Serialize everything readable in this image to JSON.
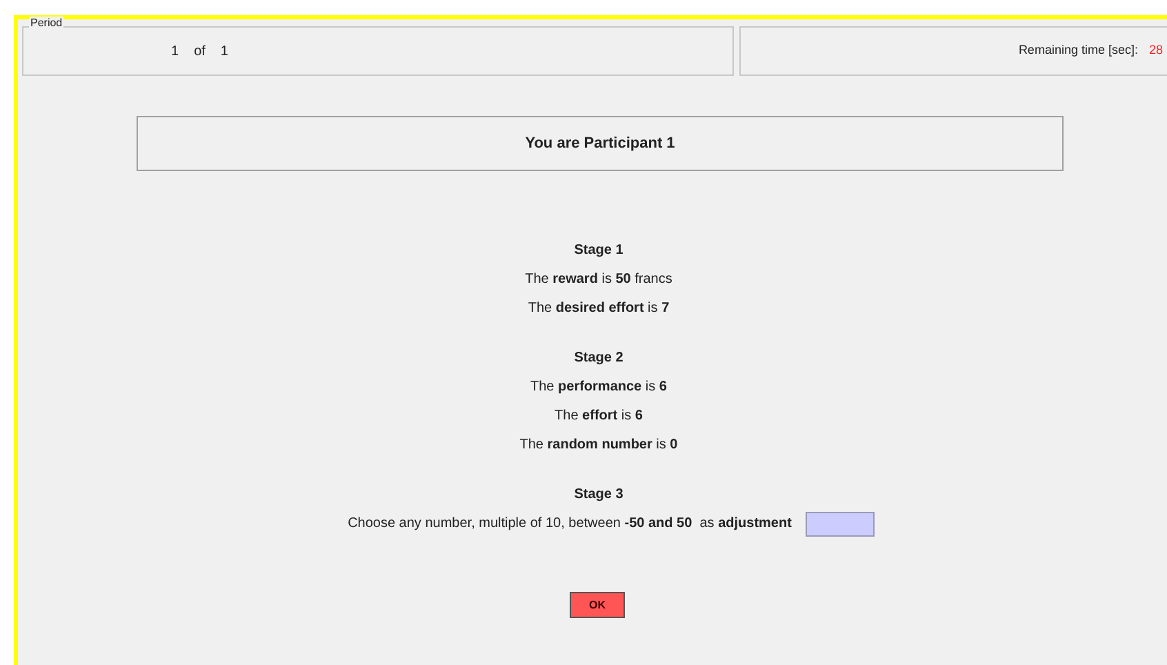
{
  "period": {
    "legend": "Period",
    "current": "1",
    "of": "of",
    "total": "1"
  },
  "timer": {
    "label": "Remaining time [sec]:",
    "value": "28"
  },
  "participant": {
    "text": "You are Participant 1"
  },
  "stages": [
    {
      "title": "Stage 1",
      "lines": [
        "The **reward** is **50** francs",
        "The **desired effort** is **7**"
      ]
    },
    {
      "title": "Stage 2",
      "lines": [
        "The **performance** is **6**",
        "The **effort** is  **6**",
        "The **random number** is  **0**"
      ]
    },
    {
      "title": "Stage 3"
    }
  ],
  "adjustment": {
    "prompt": "Choose any number, multiple of 10, between **-50 and 50**  as **adjustment**"
  },
  "ok_button": "OK"
}
